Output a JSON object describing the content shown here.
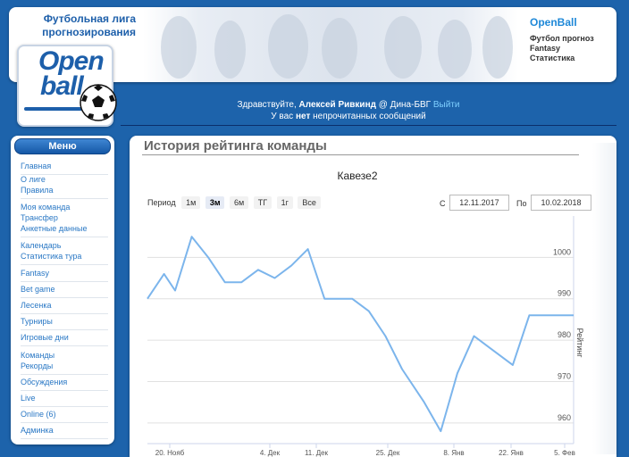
{
  "header": {
    "site_title_line1": "Футбольная лига",
    "site_title_line2": "прогнозирования",
    "brand": "OpenBall",
    "brand_links": [
      "Футбол прогноз",
      "Fantasy",
      "Статистика"
    ],
    "logo_line1": "Open",
    "logo_line2": "ball"
  },
  "greeting": {
    "hello": "Здравствуйте,",
    "user": "Алексей Ривкинд",
    "at": "@ Дина-БВГ",
    "logout": "Выйти",
    "msg_prefix": "У вас",
    "msg_bold": "нет",
    "msg_suffix": "непрочитанных сообщений"
  },
  "sidebar": {
    "title": "Меню",
    "groups": [
      [
        "Главная"
      ],
      [
        "О лиге",
        "Правила"
      ],
      [
        "Моя команда",
        "Трансфер",
        "Анкетные данные"
      ],
      [
        "Календарь",
        "Статистика тура"
      ],
      [
        "Fantasy"
      ],
      [
        "Bet game"
      ],
      [
        "Лесенка"
      ],
      [
        "Турниры"
      ],
      [
        "Игровые дни"
      ],
      [
        "Команды",
        "Рекорды"
      ],
      [
        "Обсуждения"
      ],
      [
        "Live"
      ],
      [
        "Online (6)"
      ],
      [
        "Админка"
      ]
    ]
  },
  "main": {
    "page_title": "История рейтинга команды",
    "chart_title": "Кавезе2",
    "period_label": "Период",
    "periods": [
      "1м",
      "3м",
      "6м",
      "ТГ",
      "1г",
      "Все"
    ],
    "active_period": "3м",
    "from_label": "С",
    "from_value": "12.11.2017",
    "to_label": "По",
    "to_value": "10.02.2018"
  },
  "chart_data": {
    "type": "line",
    "ylabel": "Рейтинг",
    "ylim": [
      955,
      1010
    ],
    "yticks": [
      960,
      970,
      980,
      990,
      1000
    ],
    "xtick_labels": [
      "20. Нояб",
      "4. Дек",
      "11. Дек",
      "25. Дек",
      "8. Янв",
      "22. Янв",
      "5. Фев"
    ],
    "grid": true,
    "series": [
      {
        "color": "#7cb5ec",
        "x": [
          0,
          3,
          5,
          8,
          11,
          14,
          17,
          20,
          23,
          26,
          29,
          32,
          35,
          37,
          40,
          43,
          46,
          50,
          53,
          56,
          59,
          62,
          66,
          69,
          72,
          75,
          77
        ],
        "y": [
          990,
          996,
          992,
          1005,
          1000,
          994,
          994,
          997,
          995,
          998,
          1002,
          990,
          990,
          990,
          987,
          981,
          973,
          965,
          958,
          972,
          981,
          978,
          974,
          986,
          986,
          986,
          986
        ]
      }
    ]
  }
}
